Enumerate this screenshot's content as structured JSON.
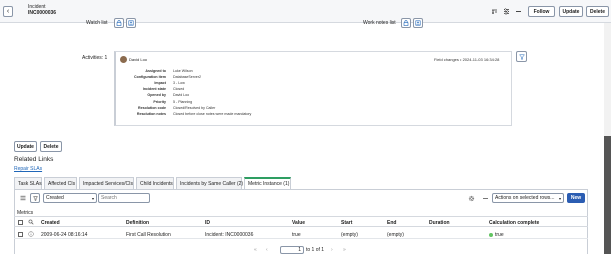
{
  "header": {
    "back_glyph": "‹",
    "title_line1": "Incident",
    "title_line2": "INC0000036",
    "buttons": {
      "follow": "Follow",
      "update": "Update",
      "delete": "Delete"
    }
  },
  "lists": {
    "watch_list": "Watch list",
    "work_notes_list": "Work notes list"
  },
  "activities": {
    "label": "Activities: 1",
    "author": "David Loo",
    "field_changes": "Field changes",
    "timestamp": "2024-11-03 16:34:28",
    "fields": [
      {
        "label": "Assigned to",
        "value": "Luke Wilson"
      },
      {
        "label": "Configuration item",
        "value": "DatabaseServer2"
      },
      {
        "label": "Impact",
        "value": "3 - Low"
      },
      {
        "label": "Incident state",
        "value": "Closed"
      },
      {
        "label": "Opened by",
        "value": "David Loo"
      },
      {
        "label": "Priority",
        "value": "5 - Planning"
      },
      {
        "label": "Resolution code",
        "value": "Closed/Resolved by Caller"
      },
      {
        "label": "Resolution notes",
        "value": "Closed before close notes were made mandatory"
      }
    ]
  },
  "form_buttons": {
    "update": "Update",
    "delete": "Delete"
  },
  "related": {
    "title": "Related Links",
    "repair_link": "Repair SLAs",
    "tabs": [
      "Task SLAs",
      "Affected CIs",
      "Impacted Services/CIs",
      "Child Incidents",
      "Incidents by Same Caller (2)",
      "Metric Instance (1)"
    ]
  },
  "list_toolbar": {
    "filter_select": "Created",
    "search_placeholder": "Search",
    "actions_select": "Actions on selected rows...",
    "new_button": "New",
    "breadcrumb": "Metrics"
  },
  "table": {
    "columns": [
      "Created",
      "Definition",
      "ID",
      "Value",
      "Start",
      "End",
      "Duration",
      "Calculation complete"
    ],
    "rows": [
      {
        "created": "2009-06-24 08:16:14",
        "definition": "First Call Resolution",
        "id": "Incident: INC0000036",
        "value": "true",
        "start": "(empty)",
        "end": "(empty)",
        "duration": "",
        "complete": "true"
      }
    ]
  },
  "pagination": {
    "page": "1",
    "to_text": "to 1 of 1"
  },
  "colors": {
    "accent": "#1f66b8",
    "new_button": "#2b5db2",
    "tab_active": "#2e9e62",
    "status_green": "#62c462"
  }
}
